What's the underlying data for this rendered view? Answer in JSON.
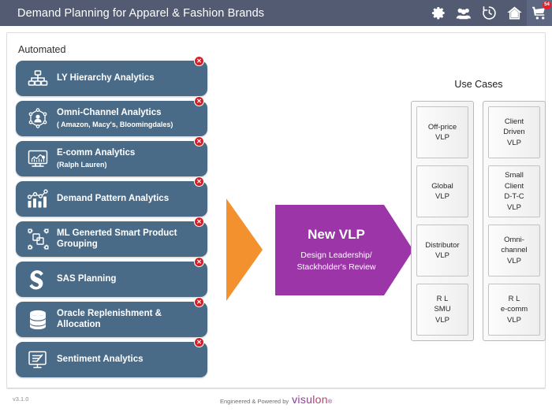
{
  "header": {
    "title": "Demand Planning for Apparel & Fashion Brands",
    "icons": [
      {
        "name": "gear-icon",
        "label": "Settings"
      },
      {
        "name": "users-icon",
        "label": "Users"
      },
      {
        "name": "history-icon",
        "label": "History"
      },
      {
        "name": "home-icon",
        "label": "Home"
      },
      {
        "name": "cart-icon",
        "label": "Cart"
      }
    ],
    "cart_badge": "54",
    "bar_color": "#525b72",
    "badge_color": "#e8212a"
  },
  "panel": {
    "section_label": "Automated",
    "card_color": "#4a6b87",
    "close_label": "✕"
  },
  "cards": [
    {
      "title": "LY Hierarchy Analytics",
      "sub": "",
      "icon": "hierarchy-icon"
    },
    {
      "title": "Omni-Channel Analytics",
      "sub": "( Amazon, Macy's, Bloomingdales)",
      "icon": "omni-channel-icon"
    },
    {
      "title": "E-comm Analytics",
      "sub": "(Ralph Lauren)",
      "icon": "ecomm-monitor-icon"
    },
    {
      "title": "Demand Pattern Analytics",
      "sub": "",
      "icon": "bar-line-chart-icon"
    },
    {
      "title": "ML Generted Smart Product Grouping",
      "sub": "",
      "icon": "grouping-icon"
    },
    {
      "title": "SAS Planning",
      "sub": "",
      "icon": "sas-logo-icon"
    },
    {
      "title": "Oracle Replenishment & Allocation",
      "sub": "",
      "icon": "database-icon"
    },
    {
      "title": "Sentiment Analytics",
      "sub": "",
      "icon": "sentiment-monitor-icon"
    }
  ],
  "flow": {
    "arrow_color": "#f2912e",
    "chevron_color": "#9b35a8",
    "chevron_title": "New VLP",
    "chevron_sub_line1": "Design Leadership/",
    "chevron_sub_line2": "Stackholder's Review"
  },
  "usecases": {
    "title": "Use Cases",
    "columns": [
      {
        "boxes": [
          "Off-price\nVLP",
          "Global\nVLP",
          "Distributor\nVLP",
          "R L\nSMU\nVLP"
        ]
      },
      {
        "boxes": [
          "Client\nDriven\nVLP",
          "Small\nClient\nD-T-C\nVLP",
          "Omni-\nchannel\nVLP",
          "R L\ne-comm\nVLP"
        ]
      }
    ]
  },
  "footer": {
    "version": "v3.1.0",
    "powered_label": "Engineered & Powered by",
    "brand": "visulon",
    "brand_mark": "®"
  }
}
